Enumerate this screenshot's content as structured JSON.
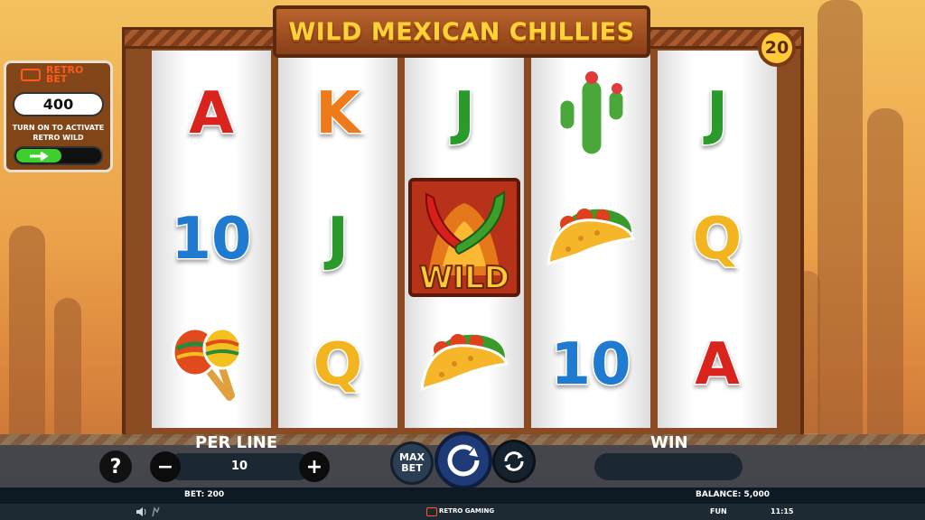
{
  "game": {
    "title": "WILD MEXICAN CHILLIES",
    "paylines": "20"
  },
  "retro_panel": {
    "brand_line1": "RETRO",
    "brand_line2": "BET",
    "value": "400",
    "text_line1": "TURN ON TO ACTIVATE",
    "text_line2": "RETRO WILD",
    "toggle_state": "on"
  },
  "reels": [
    [
      {
        "sym": "A",
        "color": "#d8241c"
      },
      {
        "sym": "10",
        "color": "#1f7ad0"
      },
      {
        "sym": "maracas",
        "icon": "maracas-icon"
      }
    ],
    [
      {
        "sym": "K",
        "color": "#f07a1a"
      },
      {
        "sym": "J",
        "color": "#2a9a2a"
      },
      {
        "sym": "Q",
        "color": "#f2b520"
      }
    ],
    [
      {
        "sym": "J",
        "color": "#2a9a2a"
      },
      {
        "sym": "WILD",
        "icon": "chilli-wild-icon"
      },
      {
        "sym": "taco",
        "icon": "taco-icon"
      }
    ],
    [
      {
        "sym": "cactus",
        "icon": "cactus-icon"
      },
      {
        "sym": "taco",
        "icon": "taco-icon"
      },
      {
        "sym": "10",
        "color": "#1f7ad0"
      }
    ],
    [
      {
        "sym": "J",
        "color": "#2a9a2a"
      },
      {
        "sym": "Q",
        "color": "#f2b520"
      },
      {
        "sym": "A",
        "color": "#d8241c"
      }
    ]
  ],
  "controls": {
    "help_label": "?",
    "per_line_label": "PER LINE",
    "per_line_value": "10",
    "minus_label": "−",
    "plus_label": "+",
    "max_bet_line1": "MAX",
    "max_bet_line2": "BET",
    "win_label": "WIN",
    "win_value": ""
  },
  "status": {
    "bet": "BET: 200",
    "balance": "BALANCE: 5,000"
  },
  "footer": {
    "brand": "RETRO GAMING",
    "mode": "FUN",
    "time": "11:15"
  }
}
